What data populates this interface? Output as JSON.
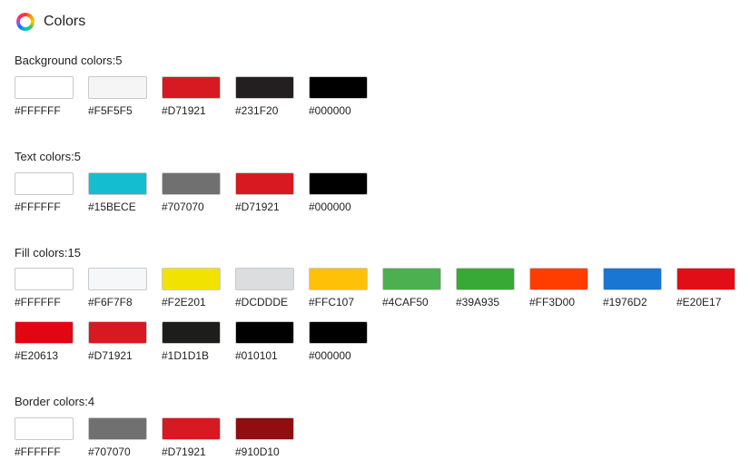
{
  "header": {
    "title": "Colors"
  },
  "sections": [
    {
      "label": "Background colors:5",
      "rows": [
        [
          {
            "hex": "#FFFFFF",
            "color": "#FFFFFF"
          },
          {
            "hex": "#F5F5F5",
            "color": "#F5F5F5"
          },
          {
            "hex": "#D71921",
            "color": "#D71921"
          },
          {
            "hex": "#231F20",
            "color": "#231F20"
          },
          {
            "hex": "#000000",
            "color": "#000000"
          }
        ]
      ]
    },
    {
      "label": "Text colors:5",
      "rows": [
        [
          {
            "hex": "#FFFFFF",
            "color": "#FFFFFF"
          },
          {
            "hex": "#15BECE",
            "color": "#15BECE"
          },
          {
            "hex": "#707070",
            "color": "#707070"
          },
          {
            "hex": "#D71921",
            "color": "#D71921"
          },
          {
            "hex": "#000000",
            "color": "#000000"
          }
        ]
      ]
    },
    {
      "label": "Fill colors:15",
      "rows": [
        [
          {
            "hex": "#FFFFFF",
            "color": "#FFFFFF"
          },
          {
            "hex": "#F6F7F8",
            "color": "#F6F7F8"
          },
          {
            "hex": "#F2E201",
            "color": "#F2E201"
          },
          {
            "hex": "#DCDDDE",
            "color": "#DCDDDE"
          },
          {
            "hex": "#FFC107",
            "color": "#FFC107"
          },
          {
            "hex": "#4CAF50",
            "color": "#4CAF50"
          },
          {
            "hex": "#39A935",
            "color": "#39A935"
          },
          {
            "hex": "#FF3D00",
            "color": "#FF3D00"
          },
          {
            "hex": "#1976D2",
            "color": "#1976D2"
          },
          {
            "hex": "#E20E17",
            "color": "#E20E17"
          }
        ],
        [
          {
            "hex": "#E20613",
            "color": "#E20613"
          },
          {
            "hex": "#D71921",
            "color": "#D71921"
          },
          {
            "hex": "#1D1D1B",
            "color": "#1D1D1B"
          },
          {
            "hex": "#010101",
            "color": "#010101"
          },
          {
            "hex": "#000000",
            "color": "#000000"
          }
        ]
      ]
    },
    {
      "label": "Border colors:4",
      "rows": [
        [
          {
            "hex": "#FFFFFF",
            "color": "#FFFFFF"
          },
          {
            "hex": "#707070",
            "color": "#707070"
          },
          {
            "hex": "#D71921",
            "color": "#D71921"
          },
          {
            "hex": "#910D10",
            "color": "#910D10"
          }
        ]
      ]
    }
  ]
}
